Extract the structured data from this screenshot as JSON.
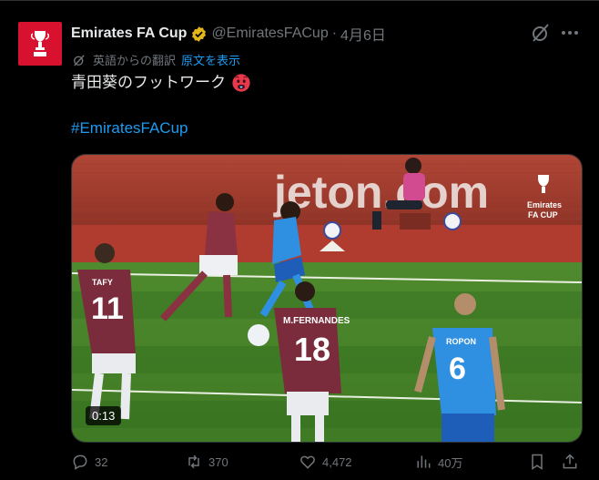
{
  "account": {
    "name": "Emirates FA Cup",
    "handle": "@EmiratesFACup",
    "separator": "·",
    "date": "4月6日"
  },
  "translation": {
    "label": "英語からの翻訳",
    "show_original": "原文を表示"
  },
  "tweet": {
    "text": "青田葵のフットワーク",
    "emoji": "hot-face-emoji",
    "hashtag": "#EmiratesFACup"
  },
  "media": {
    "board_text": "jeton.com",
    "logo_top": "Emirates",
    "logo_bottom": "FA CUP",
    "players": [
      {
        "name": "TAFY",
        "number": "11"
      },
      {
        "name": "M.FERNANDES",
        "number": "18"
      },
      {
        "name": "ROPON",
        "number": "6"
      }
    ],
    "timer": "0:13"
  },
  "actions": {
    "replies": "32",
    "reposts": "370",
    "likes": "4,472",
    "views": "40万"
  },
  "colors": {
    "brand_red": "#d8112f",
    "link_blue": "#1d9bf0",
    "muted_gray": "#71767b",
    "verified_gold": "#e2b719"
  },
  "icons": [
    "fa-cup-logo",
    "verified-badge-icon",
    "grok-icon",
    "more-icon",
    "translate-icon",
    "reply-icon",
    "repost-icon",
    "like-icon",
    "views-icon",
    "bookmark-icon",
    "share-icon"
  ]
}
